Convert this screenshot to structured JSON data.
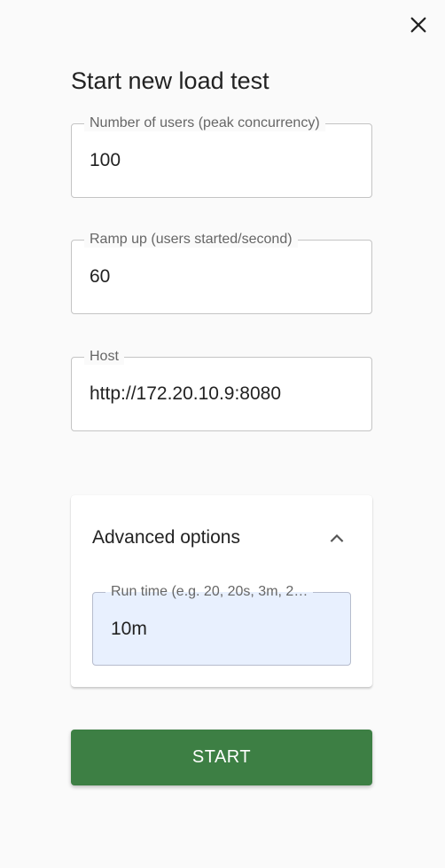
{
  "dialog": {
    "title": "Start new load test",
    "close_icon": "close-icon"
  },
  "fields": {
    "users": {
      "label": "Number of users (peak concurrency)",
      "value": "100"
    },
    "ramp_up": {
      "label": "Ramp up (users started/second)",
      "value": "60"
    },
    "host": {
      "label": "Host",
      "value": "http://172.20.10.9:8080"
    }
  },
  "advanced": {
    "title": "Advanced options",
    "expanded": true,
    "chevron_icon": "chevron-up-icon",
    "run_time": {
      "label": "Run time (e.g. 20, 20s, 3m, 2…",
      "value": "10m"
    }
  },
  "start_button": {
    "label": "START",
    "color": "#3d7f44"
  }
}
